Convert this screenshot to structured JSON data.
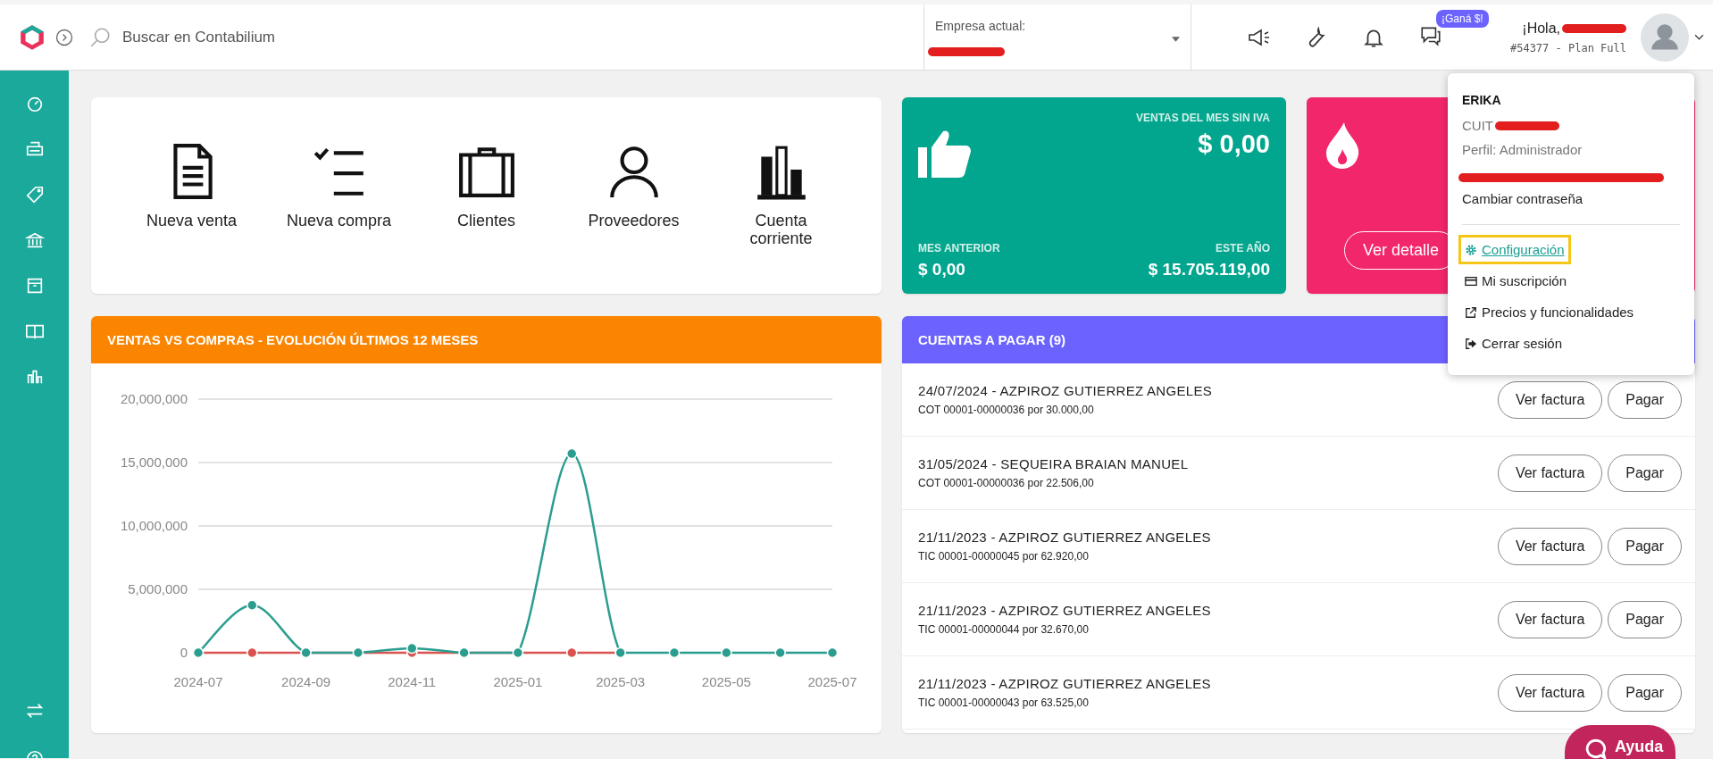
{
  "topbar": {
    "search": {
      "placeholder": "Buscar en Contabilium"
    },
    "company": {
      "label": "Empresa actual:"
    },
    "badge": "¡Ganá $!",
    "greeting": "¡Hola,",
    "plan": "#54377 - Plan Full"
  },
  "shortcuts": [
    {
      "kind": "document",
      "label": "Nueva venta"
    },
    {
      "kind": "checklist",
      "label": "Nueva compra"
    },
    {
      "kind": "briefcase",
      "label": "Clientes"
    },
    {
      "kind": "person",
      "label": "Proveedores"
    },
    {
      "kind": "bars",
      "label": "Cuenta corriente"
    }
  ],
  "sales_card": {
    "title": "VENTAS DEL MES SIN IVA",
    "amount": "$ 0,00",
    "prev_label": "MES ANTERIOR",
    "prev_amount": "$ 0,00",
    "year_label": "ESTE AÑO",
    "year_amount": "$ 15.705.119,00"
  },
  "alert_card": {
    "button": "Ver detalle"
  },
  "chart_panel": {
    "title": "VENTAS VS COMPRAS - EVOLUCIÓN ÚLTIMOS 12 MESES",
    "chart_data": {
      "type": "line",
      "x": [
        "2024-07",
        "2024-08",
        "2024-09",
        "2024-10",
        "2024-11",
        "2024-12",
        "2025-01",
        "2025-02",
        "2025-03",
        "2025-04",
        "2025-05",
        "2025-06",
        "2025-07"
      ],
      "series": [
        {
          "color": "#d9534f",
          "marker": "circle",
          "values": [
            0,
            0,
            0,
            0,
            0,
            0,
            0,
            0,
            0,
            null,
            null,
            null,
            null
          ]
        },
        {
          "color": "#2a9d8f",
          "marker": "circle",
          "values": [
            0,
            3750000,
            0,
            0,
            350000,
            0,
            0,
            15700000,
            0,
            0,
            0,
            0,
            0
          ]
        }
      ],
      "grid": true,
      "xlim": [
        "2024-07",
        "2025-07"
      ],
      "ylim": [
        0,
        20000000
      ],
      "yticks": [
        {
          "value": 0,
          "label": "0"
        },
        {
          "value": 5000000,
          "label": "5,000,000"
        },
        {
          "value": 10000000,
          "label": "10,000,000"
        },
        {
          "value": 15000000,
          "label": "15,000,000"
        },
        {
          "value": 20000000,
          "label": "20,000,000"
        }
      ],
      "xticks": [
        "2024-07",
        "2024-09",
        "2024-11",
        "2025-01",
        "2025-03",
        "2025-05",
        "2025-07"
      ]
    }
  },
  "payables": {
    "title": "CUENTAS A PAGAR (9)",
    "rows": [
      {
        "title": "24/07/2024 - AZPIROZ GUTIERREZ ANGELES",
        "detail": "COT 00001-00000036 por 30.000,00",
        "view": "Ver factura",
        "pay": "Pagar"
      },
      {
        "title": "31/05/2024 - SEQUEIRA BRAIAN MANUEL",
        "detail": "COT 00001-00000036 por 22.506,00",
        "view": "Ver factura",
        "pay": "Pagar"
      },
      {
        "title": "21/11/2023 - AZPIROZ GUTIERREZ ANGELES",
        "detail": "TIC 00001-00000045 por 62.920,00",
        "view": "Ver factura",
        "pay": "Pagar"
      },
      {
        "title": "21/11/2023 - AZPIROZ GUTIERREZ ANGELES",
        "detail": "TIC 00001-00000044 por 32.670,00",
        "view": "Ver factura",
        "pay": "Pagar"
      },
      {
        "title": "21/11/2023 - AZPIROZ GUTIERREZ ANGELES",
        "detail": "TIC 00001-00000043 por 63.525,00",
        "view": "Ver factura",
        "pay": "Pagar"
      }
    ]
  },
  "user_menu": {
    "name": "ERIKA",
    "cuit_label": "CUIT",
    "profile": "Perfil: Administrador",
    "change_password": "Cambiar contraseña",
    "items": [
      {
        "kind": "gear",
        "label": " Configuración",
        "highlighted": true
      },
      {
        "kind": "card",
        "label": "Mi suscripción",
        "highlighted": false
      },
      {
        "kind": "external",
        "label": "Precios y funcionalidades",
        "highlighted": false
      },
      {
        "kind": "logout",
        "label": "Cerrar sesión",
        "highlighted": false
      }
    ]
  },
  "help_button": "Ayuda"
}
